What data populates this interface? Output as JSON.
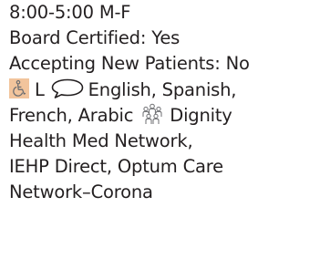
{
  "listing": {
    "hours": "8:00-5:00 M-F",
    "board_certified": "Board Certified: Yes",
    "accepting": "Accepting New Patients: No",
    "accessibility_icon": "wheelchair-icon",
    "accessibility_code": "L",
    "language_icon": "speech-bubble-icon",
    "languages_line1": "English, Spanish,",
    "languages_line2": "French, Arabic",
    "network_icon": "group-people-icon",
    "networks_line1": "Dignity",
    "networks_line2": "Health Med Network,",
    "networks_line3": "IEHP Direct, Optum Care",
    "networks_line4": "Network–Corona"
  },
  "colors": {
    "text": "#231f20",
    "accessibility_bg": "#f2c49c",
    "icon_stroke": "#6d6e71"
  }
}
